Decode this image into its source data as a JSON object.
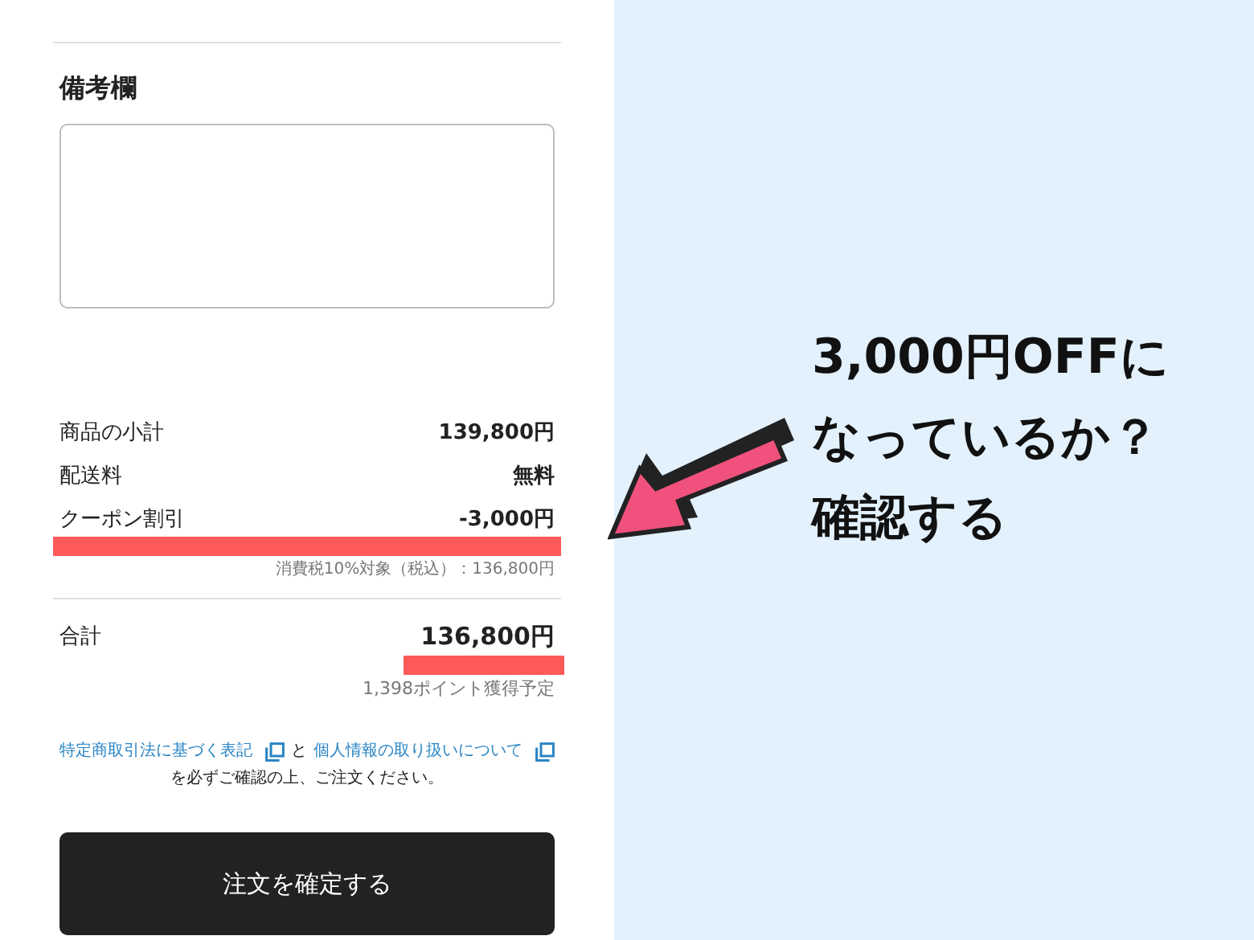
{
  "remarks": {
    "title": "備考欄"
  },
  "summary": [
    {
      "label": "商品の小計",
      "value": "139,800円",
      "highlighted": false
    },
    {
      "label": "配送料",
      "value": "無料",
      "highlighted": false
    },
    {
      "label": "クーポン割引",
      "value": "-3,000円",
      "highlighted": true
    }
  ],
  "tax_note": "消費税10%対象（税込）：136,800円",
  "total": {
    "label": "合計",
    "value": "136,800円",
    "highlighted": true
  },
  "points": "1,398ポイント獲得予定",
  "notice": {
    "link_1": "特定商取引法に基づく表記",
    "connector": "と",
    "link_2": "個人情報の取り扱いについて",
    "text": "を必ずご確認の上、ご注文ください。"
  },
  "order_button": "注文を確定する",
  "annotation": {
    "lines": [
      "3,000円OFFに",
      "なっているか？",
      "確認する"
    ]
  }
}
